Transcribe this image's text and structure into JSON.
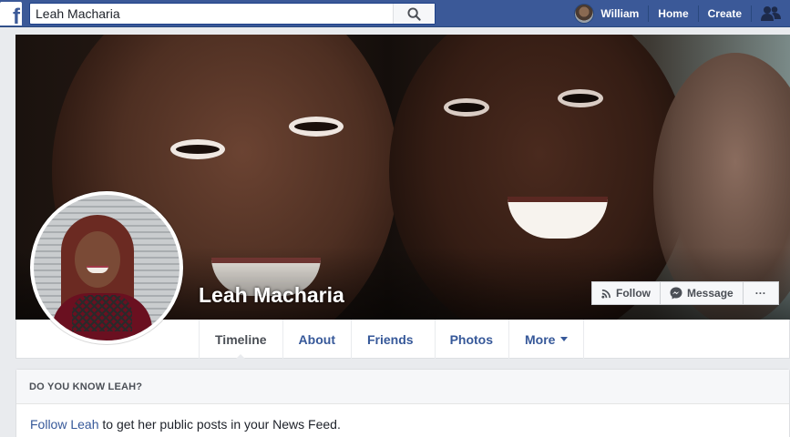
{
  "topbar": {
    "logo": "f",
    "search_value": "Leah Macharia",
    "user_name": "William",
    "home_label": "Home",
    "create_label": "Create",
    "icons": [
      "facebook-logo-icon",
      "search-icon",
      "friend-requests-icon"
    ]
  },
  "profile": {
    "name": "Leah Macharia",
    "follow_label": "Follow",
    "message_label": "Message",
    "more_actions_label": "···"
  },
  "tabs": [
    {
      "label": "Timeline",
      "active": true
    },
    {
      "label": "About"
    },
    {
      "label": "Friends"
    },
    {
      "label": "Photos"
    },
    {
      "label": "More"
    }
  ],
  "know_card": {
    "heading": "DO YOU KNOW LEAH?",
    "link_text": "Follow Leah",
    "body_text": " to get her public posts in your News Feed."
  },
  "colors": {
    "brand": "#3b5998",
    "link": "#365899",
    "background": "#e9ebee"
  }
}
